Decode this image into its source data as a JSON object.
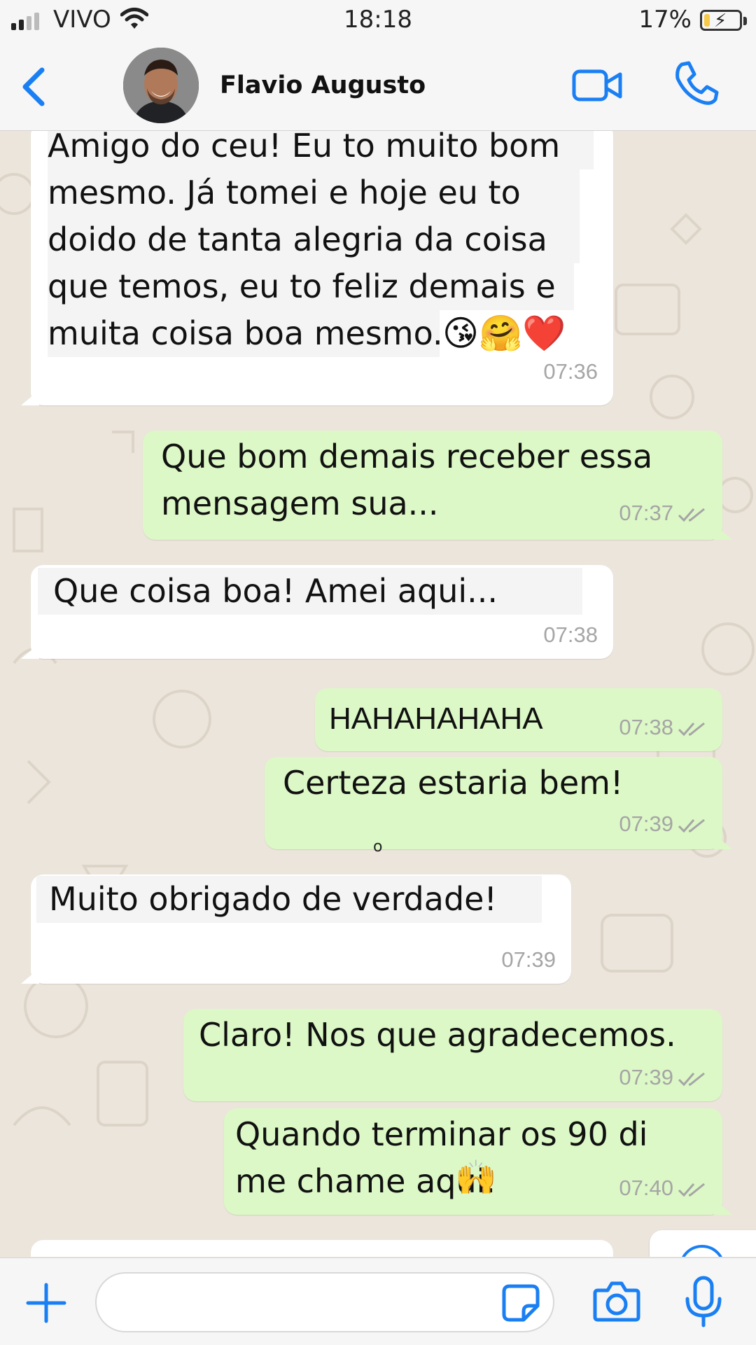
{
  "status_bar": {
    "carrier": "VIVO",
    "time": "18:18",
    "battery_percent_label": "17%",
    "battery_level": 0.17,
    "battery_color": "#f7c948"
  },
  "header": {
    "back_icon": "chevron-left-icon",
    "contact_name": "Flavio Augusto",
    "video_icon": "video-camera-icon",
    "call_icon": "phone-icon",
    "accent_color": "#1a7ff3"
  },
  "messages": [
    {
      "direction": "in",
      "lines": [
        "  Amigo do ceu! Eu to muito bom",
        "mesmo. Já tomei e hoje eu to",
        "doido de tanta alegria da coisa",
        "que temos, eu to feliz demais e",
        "muita coisa boa mesmo."
      ],
      "emoji": "😘🤗❤️",
      "time": "07:36"
    },
    {
      "direction": "out",
      "lines": [
        "Que bom demais receber essa",
        "mensagem sua..."
      ],
      "time": "07:37"
    },
    {
      "direction": "in",
      "lines": [
        "Que coisa boa! Amei aqui..."
      ],
      "time": "07:38"
    },
    {
      "direction": "out",
      "lines": [
        "HAHAHAHAHA"
      ],
      "time": "07:38"
    },
    {
      "direction": "out",
      "lines": [
        "Certeza estaria bem!"
      ],
      "time": "07:39"
    },
    {
      "direction": "in",
      "lines": [
        "Muito obrigado de verdade!"
      ],
      "time": "07:39"
    },
    {
      "direction": "out",
      "lines": [
        "Claro! Nos que agradecemos."
      ],
      "time": "07:39"
    },
    {
      "direction": "out",
      "lines": [
        "Quando terminar os 90 di",
        "me chame aqui."
      ],
      "emoji": "🙌",
      "time": "07:40"
    }
  ],
  "stray_mark": "o",
  "scroll_down_icon": "chevron-down-circle-icon",
  "bottom_bar": {
    "plus_icon": "plus-icon",
    "message_placeholder": "",
    "sticker_icon": "sticker-icon",
    "camera_icon": "camera-icon",
    "mic_icon": "microphone-icon"
  },
  "colors": {
    "outgoing_bubble": "#dcf8c6",
    "incoming_bubble": "#ffffff",
    "chat_background": "#ece5dc",
    "read_ticks": "#a5a5a5"
  }
}
